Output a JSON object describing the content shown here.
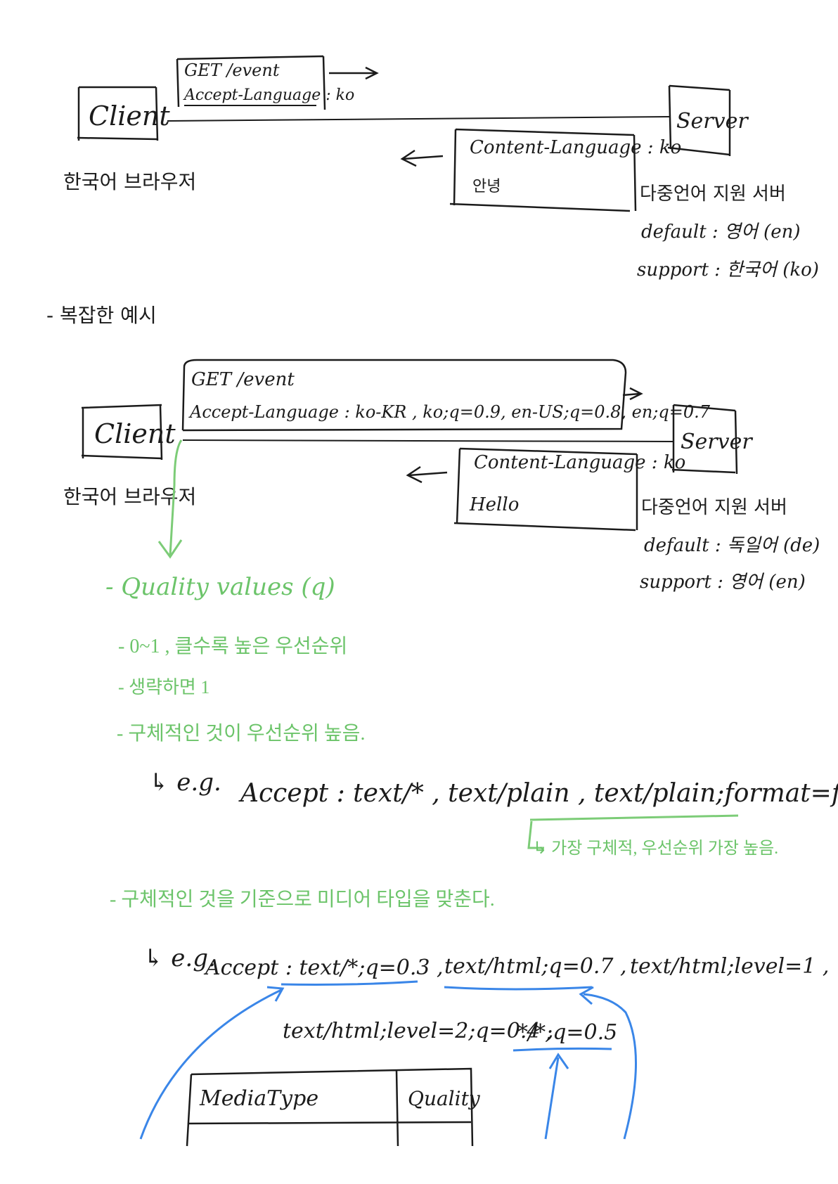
{
  "colors": {
    "ink": "#1b1b1b",
    "green": "#6cc46a",
    "blue": "#3a86e8"
  },
  "example1": {
    "client_label": "Client",
    "client_sub": "한국어 브라우저",
    "request_line1": "GET /event",
    "request_line2": "Accept-Language : ko",
    "server_label": "Server",
    "response_line1": "Content-Language : ko",
    "response_line2": "안녕",
    "server_note1": "다중언어 지원 서버",
    "server_note2": "default : 영어 (en)",
    "server_note3": "support : 한국어 (ko)"
  },
  "section_heading": "- 복잡한 예시",
  "example2": {
    "client_label": "Client",
    "client_sub": "한국어 브라우저",
    "request_line1": "GET /event",
    "request_line2": "Accept-Language : ko-KR , ko;q=0.9, en-US;q=0.8, en;q=0.7",
    "server_label": "Server",
    "response_line1": "Content-Language : ko",
    "response_line2": "Hello",
    "server_note1": "다중언어 지원 서버",
    "server_note2": "default : 독일어 (de)",
    "server_note3": "support : 영어 (en)"
  },
  "notes": {
    "quality_title": "- Quality values (q)",
    "bullet1": "- 0~1 , 클수록 높은 우선순위",
    "bullet2": "- 생략하면 1",
    "bullet3": "- 구체적인 것이 우선순위 높음.",
    "eg1_prefix": "↳ e.g.",
    "eg1_text": "Accept : text/* , text/plain , text/plain;format=flowed , */*",
    "eg1_note": "↳ 가장 구체적, 우선순위 가장 높음.",
    "bullet4": "- 구체적인 것을 기준으로 미디어 타입을 맞춘다.",
    "eg2_prefix": "↳ e.g.",
    "eg2_line1_a": "Accept : text/*;q=0.3 ,",
    "eg2_line1_b": "text/html;q=0.7 ,",
    "eg2_line1_c": "text/html;level=1 ,",
    "eg2_line2_a": "text/html;level=2;q=0.4 ,",
    "eg2_line2_b": "*/*;q=0.5",
    "table_col1": "MediaType",
    "table_col2": "Quality"
  }
}
